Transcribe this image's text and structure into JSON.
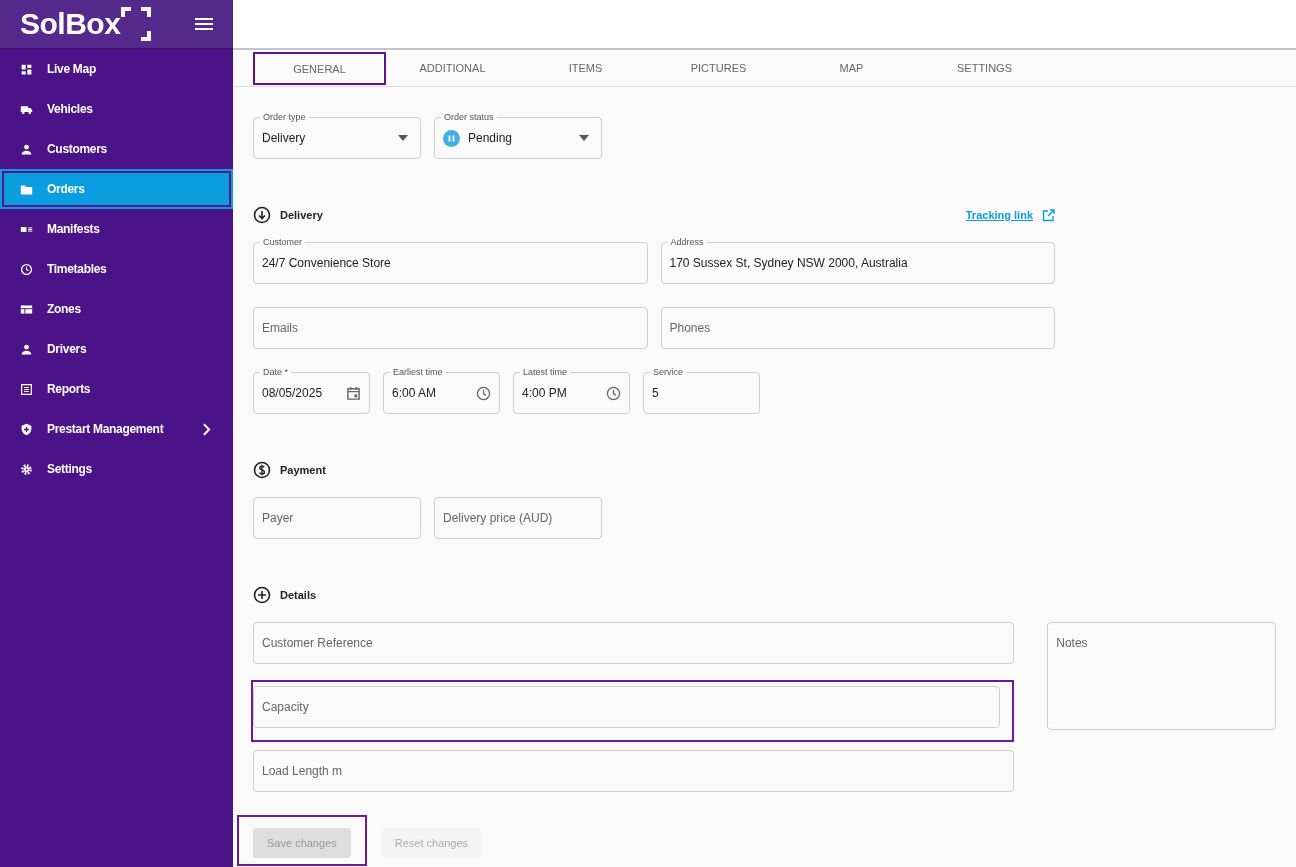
{
  "sidebar": {
    "logo": "SolBox",
    "items": [
      {
        "label": "Live Map",
        "selected": false,
        "highlighted": false,
        "has_submenu": false
      },
      {
        "label": "Vehicles",
        "selected": false,
        "highlighted": false,
        "has_submenu": false
      },
      {
        "label": "Customers",
        "selected": false,
        "highlighted": false,
        "has_submenu": false
      },
      {
        "label": "Orders",
        "selected": true,
        "highlighted": true,
        "has_submenu": false
      },
      {
        "label": "Manifests",
        "selected": false,
        "highlighted": false,
        "has_submenu": false
      },
      {
        "label": "Timetables",
        "selected": false,
        "highlighted": false,
        "has_submenu": false
      },
      {
        "label": "Zones",
        "selected": false,
        "highlighted": false,
        "has_submenu": false
      },
      {
        "label": "Drivers",
        "selected": false,
        "highlighted": false,
        "has_submenu": false
      },
      {
        "label": "Reports",
        "selected": false,
        "highlighted": false,
        "has_submenu": false
      },
      {
        "label": "Prestart Management",
        "selected": false,
        "highlighted": false,
        "has_submenu": true
      },
      {
        "label": "Settings",
        "selected": false,
        "highlighted": false,
        "has_submenu": false
      }
    ]
  },
  "tabs": [
    {
      "label": "GENERAL",
      "highlighted": true
    },
    {
      "label": "ADDITIONAL",
      "highlighted": false
    },
    {
      "label": "ITEMS",
      "highlighted": false
    },
    {
      "label": "PICTURES",
      "highlighted": false
    },
    {
      "label": "MAP",
      "highlighted": false
    },
    {
      "label": "SETTINGS",
      "highlighted": false
    }
  ],
  "order_fields": [
    {
      "kind": "select",
      "label": "Order type",
      "value": "Delivery"
    },
    {
      "kind": "status_select",
      "label": "Order status",
      "value": "Pending"
    }
  ],
  "delivery": {
    "title": "Delivery",
    "tracking_link": "Tracking link",
    "rows": [
      [
        {
          "kind": "text",
          "label": "Customer",
          "value": "24/7 Convenience Store"
        },
        {
          "kind": "text",
          "label": "Address",
          "value": "170 Sussex St, Sydney NSW 2000, Australia"
        }
      ],
      [
        {
          "kind": "text",
          "placeholder": "Emails"
        },
        {
          "kind": "text",
          "placeholder": "Phones"
        }
      ],
      [
        {
          "kind": "date",
          "label": "Date *",
          "value": "08/05/2025"
        },
        {
          "kind": "time",
          "label": "Earliest time",
          "value": "6:00 AM"
        },
        {
          "kind": "time",
          "label": "Latest time",
          "value": "4:00 PM"
        },
        {
          "kind": "text",
          "label": "Service",
          "value": "5"
        }
      ]
    ]
  },
  "payment": {
    "title": "Payment",
    "fields": [
      {
        "placeholder": "Payer"
      },
      {
        "placeholder": "Delivery price (AUD)"
      }
    ]
  },
  "details": {
    "title": "Details",
    "fields": [
      {
        "placeholder": "Customer Reference",
        "highlighted": false
      },
      {
        "placeholder": "Capacity",
        "highlighted": true
      },
      {
        "placeholder": "Load Length m",
        "highlighted": false
      }
    ],
    "notes": {
      "placeholder": "Notes"
    }
  },
  "actions": [
    {
      "label": "Save changes",
      "disabled": true,
      "highlighted": true
    },
    {
      "label": "Reset changes",
      "disabled": true,
      "highlighted": false
    }
  ]
}
